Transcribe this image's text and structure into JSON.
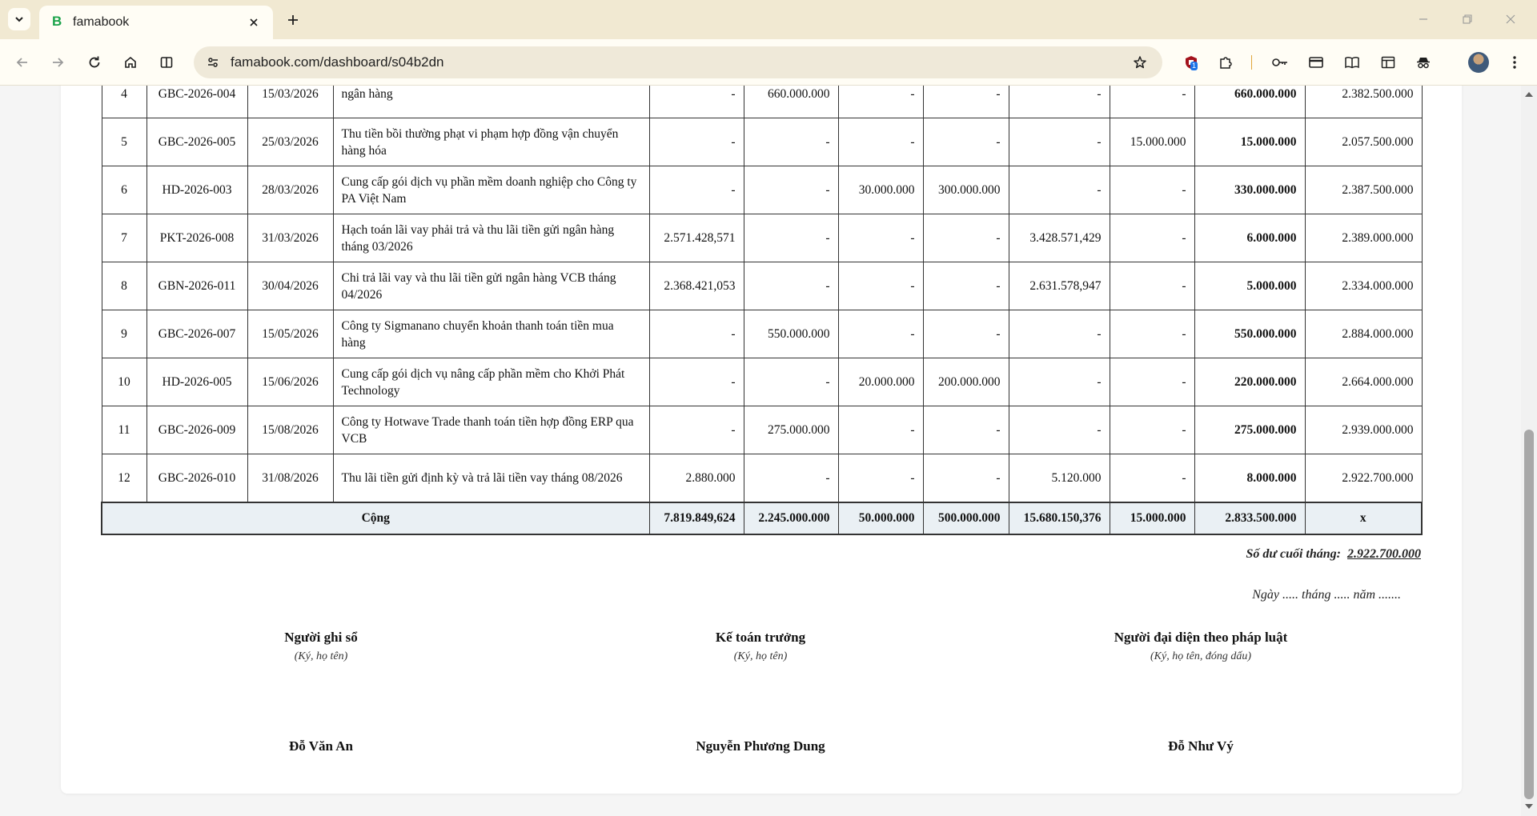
{
  "browser": {
    "tab_title": "famabook",
    "favicon_letter": "B",
    "url": "famabook.com/dashboard/s04b2dn",
    "extension_badge": "1"
  },
  "ledger": {
    "rows": [
      {
        "stt": "4",
        "so": "GBC-2026-004",
        "ngay": "15/03/2026",
        "dien_giai": "ngân hàng",
        "c1": "-",
        "c2": "660.000.000",
        "c3": "-",
        "c4": "-",
        "c5": "-",
        "c6": "-",
        "cong": "660.000.000",
        "so_du": "2.382.500.000"
      },
      {
        "stt": "5",
        "so": "GBC-2026-005",
        "ngay": "25/03/2026",
        "dien_giai": "Thu tiền bồi thường phạt vi phạm hợp đồng vận chuyển hàng hóa",
        "c1": "-",
        "c2": "-",
        "c3": "-",
        "c4": "-",
        "c5": "-",
        "c6": "15.000.000",
        "cong": "15.000.000",
        "so_du": "2.057.500.000"
      },
      {
        "stt": "6",
        "so": "HD-2026-003",
        "ngay": "28/03/2026",
        "dien_giai": "Cung cấp gói dịch vụ phần mềm doanh nghiệp cho Công ty PA Việt Nam",
        "c1": "-",
        "c2": "-",
        "c3": "30.000.000",
        "c4": "300.000.000",
        "c5": "-",
        "c6": "-",
        "cong": "330.000.000",
        "so_du": "2.387.500.000"
      },
      {
        "stt": "7",
        "so": "PKT-2026-008",
        "ngay": "31/03/2026",
        "dien_giai": "Hạch toán lãi vay phải trả và thu lãi tiền gửi ngân hàng tháng 03/2026",
        "c1": "2.571.428,571",
        "c2": "-",
        "c3": "-",
        "c4": "-",
        "c5": "3.428.571,429",
        "c6": "-",
        "cong": "6.000.000",
        "so_du": "2.389.000.000"
      },
      {
        "stt": "8",
        "so": "GBN-2026-011",
        "ngay": "30/04/2026",
        "dien_giai": "Chi trả lãi vay và thu lãi tiền gửi ngân hàng VCB tháng 04/2026",
        "c1": "2.368.421,053",
        "c2": "-",
        "c3": "-",
        "c4": "-",
        "c5": "2.631.578,947",
        "c6": "-",
        "cong": "5.000.000",
        "so_du": "2.334.000.000"
      },
      {
        "stt": "9",
        "so": "GBC-2026-007",
        "ngay": "15/05/2026",
        "dien_giai": "Công ty Sigmanano chuyển khoản thanh toán tiền mua hàng",
        "c1": "-",
        "c2": "550.000.000",
        "c3": "-",
        "c4": "-",
        "c5": "-",
        "c6": "-",
        "cong": "550.000.000",
        "so_du": "2.884.000.000"
      },
      {
        "stt": "10",
        "so": "HD-2026-005",
        "ngay": "15/06/2026",
        "dien_giai": "Cung cấp gói dịch vụ nâng cấp phần mềm cho Khởi Phát Technology",
        "c1": "-",
        "c2": "-",
        "c3": "20.000.000",
        "c4": "200.000.000",
        "c5": "-",
        "c6": "-",
        "cong": "220.000.000",
        "so_du": "2.664.000.000"
      },
      {
        "stt": "11",
        "so": "GBC-2026-009",
        "ngay": "15/08/2026",
        "dien_giai": "Công ty Hotwave Trade thanh toán tiền hợp đồng ERP qua VCB",
        "c1": "-",
        "c2": "275.000.000",
        "c3": "-",
        "c4": "-",
        "c5": "-",
        "c6": "-",
        "cong": "275.000.000",
        "so_du": "2.939.000.000"
      },
      {
        "stt": "12",
        "so": "GBC-2026-010",
        "ngay": "31/08/2026",
        "dien_giai": "Thu lãi tiền gửi định kỳ và trả lãi tiền vay tháng 08/2026",
        "c1": "2.880.000",
        "c2": "-",
        "c3": "-",
        "c4": "-",
        "c5": "5.120.000",
        "c6": "-",
        "cong": "8.000.000",
        "so_du": "2.922.700.000"
      }
    ],
    "total": {
      "label": "Cộng",
      "c1": "7.819.849,624",
      "c2": "2.245.000.000",
      "c3": "50.000.000",
      "c4": "500.000.000",
      "c5": "15.680.150,376",
      "c6": "15.000.000",
      "cong": "2.833.500.000",
      "so_du": "x"
    }
  },
  "footer": {
    "ending_label": "Số dư cuối tháng:",
    "ending_value": "2.922.700.000",
    "date_line": "Ngày ..... tháng ..... năm .......",
    "signatures": [
      {
        "role": "Người ghi sổ",
        "hint": "(Ký, họ tên)",
        "name": "Đỗ Văn An"
      },
      {
        "role": "Kế toán trưởng",
        "hint": "(Ký, họ tên)",
        "name": "Nguyễn Phương Dung"
      },
      {
        "role": "Người đại diện theo pháp luật",
        "hint": "(Ký, họ tên, đóng dấu)",
        "name": "Đỗ Như Vý"
      }
    ]
  }
}
